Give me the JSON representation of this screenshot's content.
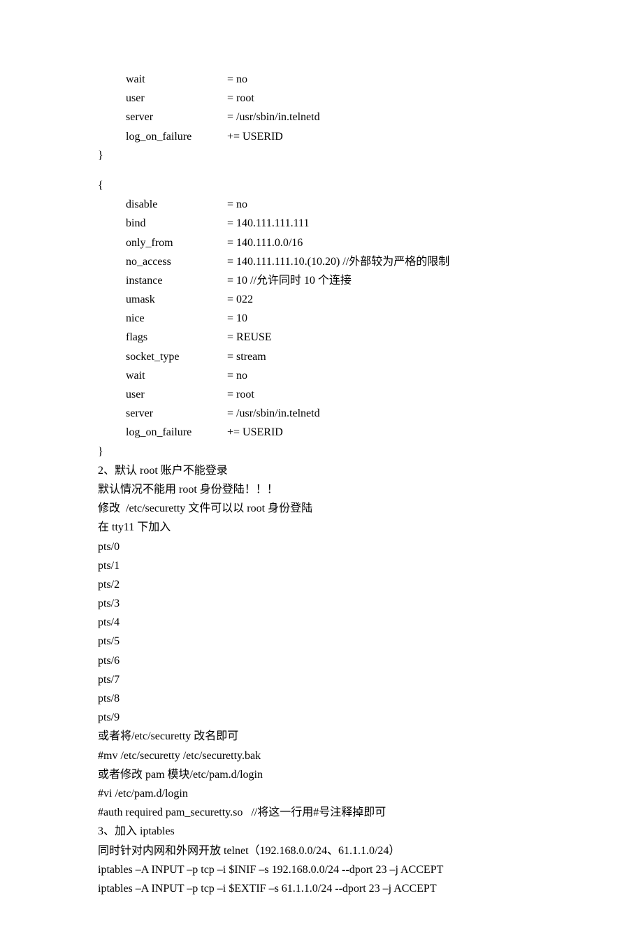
{
  "block1": {
    "rows": [
      {
        "key": "wait",
        "val": "= no"
      },
      {
        "key": "user",
        "val": "= root"
      },
      {
        "key": "server",
        "val": "= /usr/sbin/in.telnetd"
      },
      {
        "key": "log_on_failure",
        "val": "+= USERID"
      }
    ],
    "close": "}"
  },
  "block2": {
    "open": "{",
    "rows": [
      {
        "key": "disable",
        "val": "= no"
      },
      {
        "key": "bind",
        "val": "= 140.111.111.111"
      },
      {
        "key": "only_from",
        "val": "= 140.111.0.0/16"
      },
      {
        "key": "no_access",
        "val": "= 140.111.111.10.(10.20)      //外部较为严格的限制"
      },
      {
        "key": "instance",
        "val": "= 10       //允许同时 10 个连接"
      },
      {
        "key": "umask",
        "val": "= 022"
      },
      {
        "key": "nice",
        "val": "= 10"
      },
      {
        "key": "flags",
        "val": "= REUSE"
      },
      {
        "key": "socket_type",
        "val": "= stream"
      },
      {
        "key": "wait",
        "val": "= no"
      },
      {
        "key": "user",
        "val": "= root"
      },
      {
        "key": "server",
        "val": "= /usr/sbin/in.telnetd"
      },
      {
        "key": "log_on_failure",
        "val": "+= USERID"
      }
    ],
    "close": "}"
  },
  "body_lines": [
    "2、默认 root 账户不能登录",
    "默认情况不能用 root 身份登陆！！！",
    "修改  /etc/securetty 文件可以以 root 身份登陆",
    "在 tty11 下加入",
    "pts/0",
    "pts/1",
    "pts/2",
    "pts/3",
    "pts/4",
    "pts/5",
    "pts/6",
    "pts/7",
    "pts/8",
    "pts/9",
    "或者将/etc/securetty 改名即可",
    "#mv /etc/securetty /etc/securetty.bak",
    "或者修改 pam 模块/etc/pam.d/login",
    "#vi /etc/pam.d/login",
    "#auth required pam_securetty.so   //将这一行用#号注释掉即可",
    "3、加入 iptables",
    "同时针对内网和外网开放 telnet（192.168.0.0/24、61.1.1.0/24）",
    "iptables –A INPUT –p tcp –i $INIF –s 192.168.0.0/24 --dport 23 –j ACCEPT",
    "iptables –A INPUT –p tcp –i $EXTIF –s 61.1.1.0/24 --dport 23 –j ACCEPT"
  ]
}
